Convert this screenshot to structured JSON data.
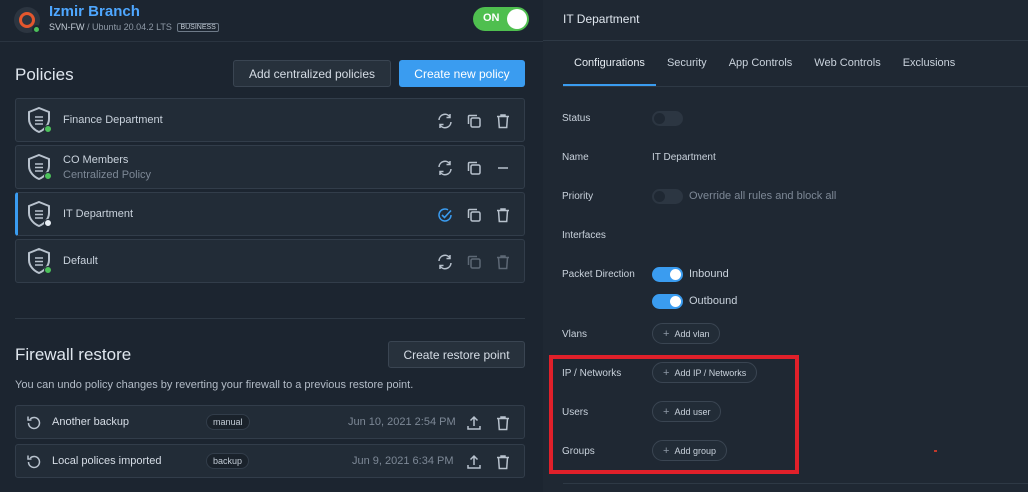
{
  "header": {
    "title": "Izmir Branch",
    "host": "SVN-FW",
    "separator": "/",
    "os": "Ubuntu 20.04.2 LTS",
    "edition": "BUSINESS",
    "power_toggle": "ON"
  },
  "policies": {
    "title": "Policies",
    "add_centralized_label": "Add centralized policies",
    "create_label": "Create new policy",
    "items": [
      {
        "name": "Finance Department",
        "subtitle": ""
      },
      {
        "name": "CO Members",
        "subtitle": "Centralized Policy"
      },
      {
        "name": "IT Department",
        "subtitle": ""
      },
      {
        "name": "Default",
        "subtitle": ""
      }
    ]
  },
  "restore": {
    "title": "Firewall restore",
    "create_label": "Create restore point",
    "description": "You can undo policy changes by reverting your firewall to a previous restore point.",
    "items": [
      {
        "name": "Another backup",
        "tag": "manual",
        "date": "Jun 10, 2021 2:54 PM"
      },
      {
        "name": "Local polices imported",
        "tag": "backup",
        "date": "Jun 9, 2021 6:34 PM"
      }
    ]
  },
  "detail": {
    "title": "IT Department",
    "tabs": [
      "Configurations",
      "Security",
      "App Controls",
      "Web Controls",
      "Exclusions"
    ],
    "fields": {
      "status_label": "Status",
      "name_label": "Name",
      "name_value": "IT Department",
      "priority_label": "Priority",
      "priority_option": "Override all rules and block all",
      "interfaces_label": "Interfaces",
      "packet_direction_label": "Packet Direction",
      "inbound_label": "Inbound",
      "outbound_label": "Outbound",
      "vlans_label": "Vlans",
      "add_vlan": "Add vlan",
      "ip_networks_label": "IP / Networks",
      "add_ip": "Add IP / Networks",
      "users_label": "Users",
      "add_user": "Add user",
      "groups_label": "Groups",
      "add_group": "Add group"
    }
  },
  "colors": {
    "accent": "#3a9cf0",
    "on_green": "#4fbf4f",
    "highlight_red": "#e0202a"
  }
}
